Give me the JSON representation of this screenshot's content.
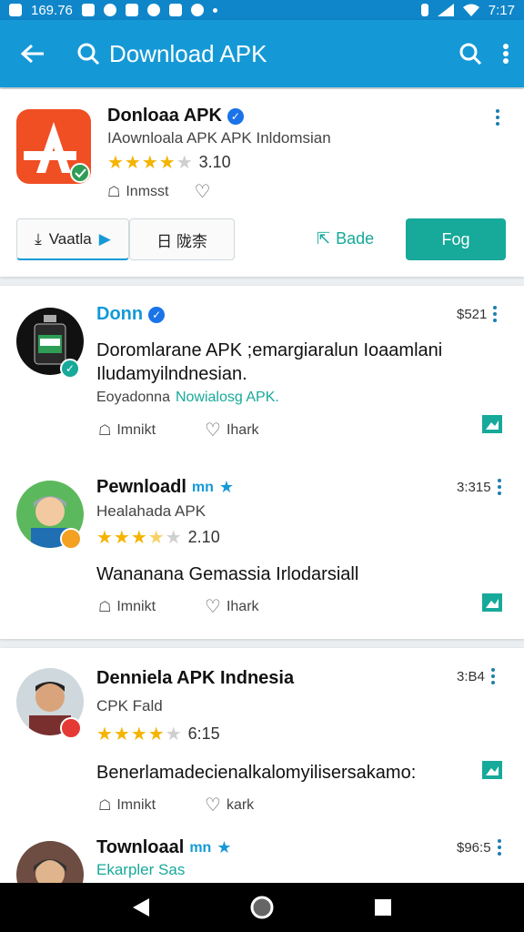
{
  "status_bar": {
    "left_text": "169.76",
    "right_text": "7:17"
  },
  "app_bar": {
    "title": "Download APK"
  },
  "featured": {
    "title": "Donloaa APK",
    "subtitle": "IAownloala APK APK Inldomsian",
    "rating_value": "3.10",
    "stars": 4,
    "meta_label": "Inmsst",
    "button1_label": "Vaatla",
    "button2_label": "日 陇柰",
    "share_label": "Bade",
    "primary_label": "Fog",
    "colors": {
      "accent": "#17a99a",
      "brand": "#1599d6"
    }
  },
  "posts": [
    {
      "title": "Donn",
      "time": "$521",
      "description": "Doromlarane APK ;emargiaralun Ioaamlani Iludamyilndnesian.",
      "footer_prefix": "Eoyadonna",
      "footer_link": "Nowialosg APK.",
      "meta1": "Imnikt",
      "meta2": "Ihark"
    },
    {
      "title": "Pewnloadl",
      "title_suffix": "mn",
      "time": "3:315",
      "subtitle": "Healahada APK",
      "rating_value": "2.10",
      "stars": 3.5,
      "description": "Wananana Gemassia Irlodarsiall",
      "meta1": "Imnikt",
      "meta2": "Ihark"
    },
    {
      "title": "Denniela APK Indnesia",
      "time": "3:B4",
      "subtitle": "CPK Fald",
      "rating_value": "6:15",
      "stars": 4,
      "description": "Benerlamadecienalkalomyilisersakamo:",
      "meta1": "Imnikt",
      "meta2": "kark"
    },
    {
      "title": "Townloaal",
      "title_suffix": "mn",
      "time": "$96:5",
      "subtitle": "Ekarpler Sas"
    }
  ]
}
